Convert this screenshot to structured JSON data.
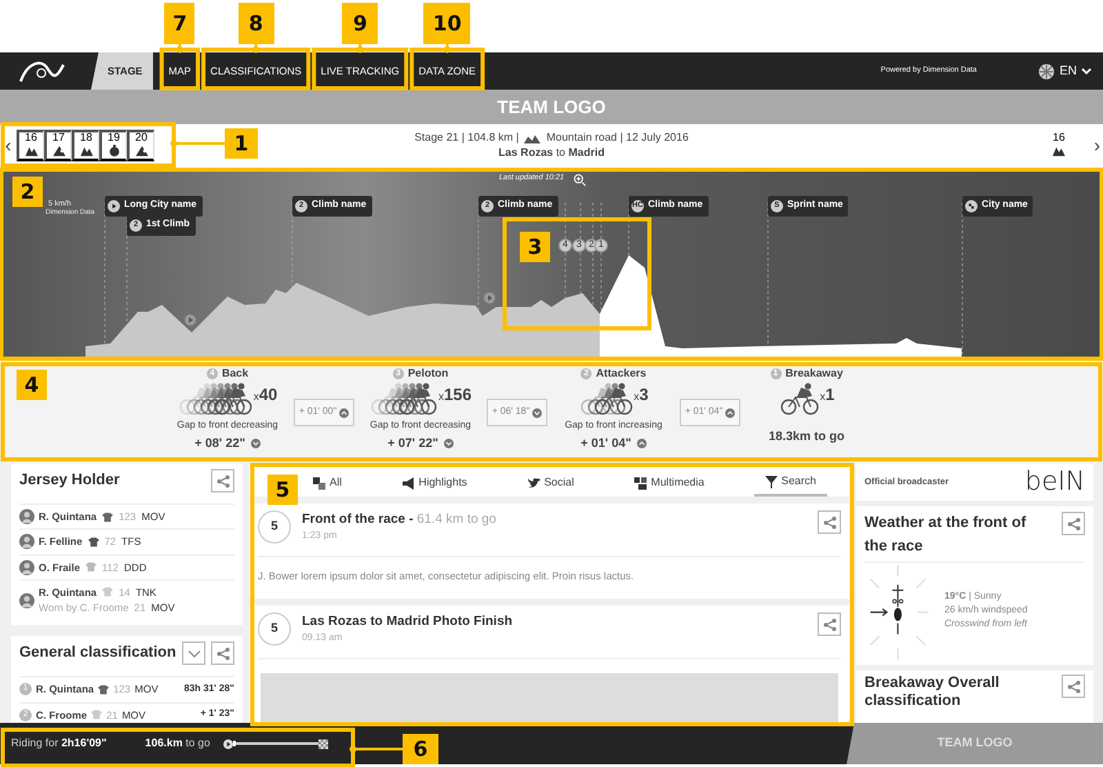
{
  "nav": {
    "tabs": [
      {
        "label": "STAGE",
        "selected": true
      },
      {
        "label": "MAP",
        "selected": false
      },
      {
        "label": "CLASSIFICATIONS",
        "selected": false
      },
      {
        "label": "LIVE TRACKING",
        "selected": false
      },
      {
        "label": "DATA ZONE",
        "selected": false
      }
    ],
    "powered": "Powered by Dimension Data",
    "language": "EN"
  },
  "header_bar": {
    "title": "TEAM LOGO"
  },
  "stage_selector": {
    "prev": "‹",
    "next": "›",
    "stages": [
      {
        "number": "16",
        "kind": "mountain"
      },
      {
        "number": "17",
        "kind": "hill"
      },
      {
        "number": "18",
        "kind": "mountain"
      },
      {
        "number": "19",
        "kind": "time_trial"
      },
      {
        "number": "20",
        "kind": "hill"
      }
    ],
    "info_left": "Stage 21 | 104.8 km |",
    "info_right": "Mountain road | 12 July 2016",
    "route": "**Las Rozas** to **Madrid**",
    "next_stage": {
      "number": "16",
      "kind": "mountain"
    }
  },
  "profile": {
    "updated": "Last updated 10:21",
    "legend": "5 km/h",
    "credit": "Dimension Data",
    "markers": [
      {
        "label": "Long City name",
        "kind": "start"
      },
      {
        "label": "1st Climb",
        "kind": "climb",
        "category": "2"
      },
      {
        "label": "Climb name",
        "kind": "climb",
        "category": "2"
      },
      {
        "label": "Climb name",
        "kind": "climb",
        "category": "2"
      },
      {
        "label": "Climb name",
        "kind": "climb",
        "category": "HC"
      },
      {
        "label": "Sprint name",
        "kind": "sprint",
        "category": "S"
      },
      {
        "label": "City name",
        "kind": "finish"
      }
    ],
    "group_markers": [
      "4",
      "3",
      "2",
      "1"
    ]
  },
  "groups": [
    {
      "rank": "4",
      "name": "Back",
      "kind": "back",
      "multiplier": "x",
      "count": "40",
      "note": "Gap to front decreasing",
      "gap": "+ 08' 22\"",
      "trend_up": false
    },
    {
      "rank": "3",
      "name": "Peloton",
      "kind": "peloton",
      "multiplier": "x",
      "count": "156",
      "note": "Gap to front decreasing",
      "gap": "+ 07' 22\"",
      "trend_up": false
    },
    {
      "rank": "2",
      "name": "Attackers",
      "kind": "attackers",
      "multiplier": "x",
      "count": "3",
      "note": "Gap to front increasing",
      "gap": "+ 01' 04\"",
      "trend_up": true
    },
    {
      "rank": "1",
      "name": "Breakaway",
      "kind": "breakaway",
      "multiplier": "x",
      "count": "1",
      "to_go": "18.3km to go"
    }
  ],
  "gaps": [
    {
      "value": "+ 01' 00\"",
      "trend_up": true
    },
    {
      "value": "+ 06' 18\"",
      "trend_up": false
    },
    {
      "value": "+ 01' 04\"",
      "trend_up": true
    }
  ],
  "jersey_holders": {
    "title": "Jersey Holder",
    "rows": [
      {
        "name": "R. Quintana",
        "number": "123",
        "team": "MOV",
        "color": "#666666"
      },
      {
        "name": "F. Felline",
        "number": "72",
        "team": "TFS",
        "color": "#555555"
      },
      {
        "name": "O. Fraile",
        "number": "112",
        "team": "DDD",
        "color": "#bbbbbb"
      },
      {
        "name": "R. Quintana",
        "number": "14",
        "team": "TNK",
        "color": "#cccccc",
        "worn_by": "Worn by C. Froome",
        "worn_number": "21",
        "worn_team": "MOV"
      }
    ]
  },
  "general_classification": {
    "title": "General classification",
    "rows": [
      {
        "rank": "1",
        "name": "R. Quintana",
        "number": "123",
        "team": "MOV",
        "time": "83h 31' 28\"",
        "color": "#666666"
      },
      {
        "rank": "2",
        "name": "C. Froome",
        "number": "21",
        "team": "MOV",
        "time": "+ 1' 23\"",
        "color": "#cccccc"
      }
    ]
  },
  "feed": {
    "tabs": [
      {
        "label": "All",
        "kind": "all",
        "selected": false
      },
      {
        "label": "Highlights",
        "kind": "highlights",
        "selected": false
      },
      {
        "label": "Social",
        "kind": "social",
        "selected": false
      },
      {
        "label": "Multimedia",
        "kind": "multimedia",
        "selected": false
      },
      {
        "label": "Search",
        "kind": "search",
        "selected": true
      }
    ],
    "posts": [
      {
        "kind": "text",
        "badge": "5",
        "title": "**Front of the race -** 61.4 km to go",
        "time": "1:23 pm",
        "body": "J. Bower lorem ipsum dolor sit amet, consectetur adipiscing elit. Proin risus lactus."
      },
      {
        "kind": "photo",
        "badge": "5",
        "title": "**Las Rozas to Madrid Photo Finish**",
        "time": "09.13 am"
      }
    ]
  },
  "broadcaster": {
    "label": "Official broadcaster",
    "logo": "beIN"
  },
  "weather": {
    "title": "Weather at the front of the race",
    "reading": "**19°C** | Sunny",
    "wind": "26 km/h windspeed",
    "note": "Crosswind from left"
  },
  "breakaway_classification": {
    "title": "Breakaway Overall classification"
  },
  "bottom_bar": {
    "riding": "Riding for **2h16'09\"**",
    "to_go": "**106.km** to go",
    "level": 0.03,
    "team_logo": "TEAM LOGO"
  },
  "callouts": [
    "7",
    "8",
    "9",
    "10",
    "1",
    "2",
    "3",
    "4",
    "5",
    "6"
  ]
}
